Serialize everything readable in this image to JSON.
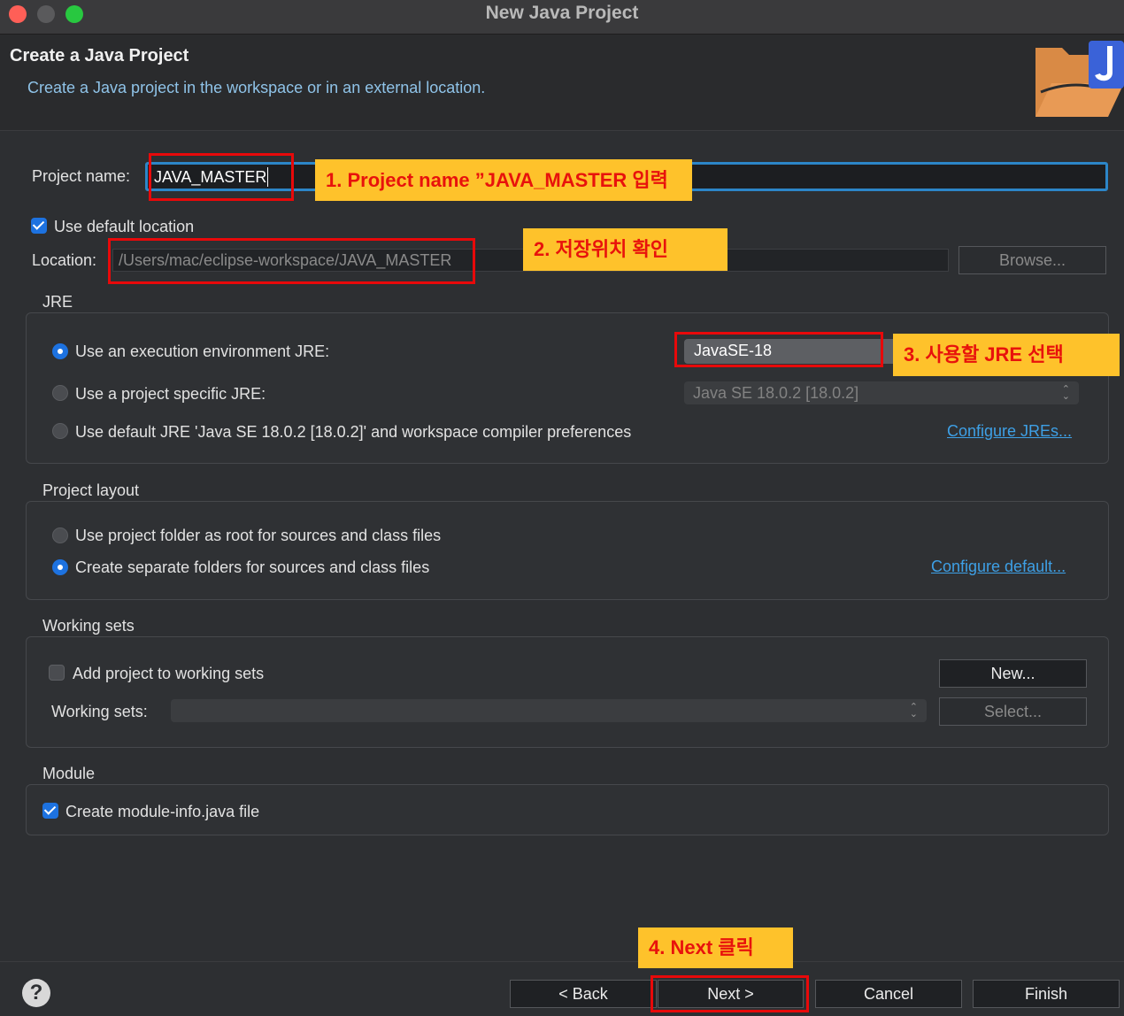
{
  "window": {
    "title": "New Java Project"
  },
  "header": {
    "title": "Create a Java Project",
    "description": "Create a Java project in the workspace or in an external location."
  },
  "project": {
    "name_label": "Project name:",
    "name_value": "JAVA_MASTER"
  },
  "location": {
    "use_default_label": "Use default location",
    "use_default_checked": true,
    "label": "Location:",
    "value": "/Users/mac/eclipse-workspace/JAVA_MASTER",
    "browse_label": "Browse..."
  },
  "jre": {
    "group_label": "JRE",
    "option_exec_env": "Use an execution environment JRE:",
    "exec_env_value": "JavaSE-18",
    "option_specific": "Use a project specific JRE:",
    "specific_value": "Java SE 18.0.2 [18.0.2]",
    "option_default": "Use default JRE 'Java SE 18.0.2 [18.0.2]' and workspace compiler preferences",
    "configure_link": "Configure JREs..."
  },
  "layout": {
    "group_label": "Project layout",
    "option_root": "Use project folder as root for sources and class files",
    "option_separate": "Create separate folders for sources and class files",
    "configure_link": "Configure default..."
  },
  "working_sets": {
    "group_label": "Working sets",
    "add_label": "Add project to working sets",
    "sets_label": "Working sets:",
    "new_button": "New...",
    "select_button": "Select..."
  },
  "module": {
    "group_label": "Module",
    "create_label": "Create module-info.java file",
    "checked": true
  },
  "footer": {
    "back": "< Back",
    "next": "Next >",
    "cancel": "Cancel",
    "finish": "Finish",
    "help": "?"
  },
  "annotations": {
    "step1": "1. Project name ”JAVA_MASTER 입력",
    "step2": "2. 저장위치 확인",
    "step3": "3. 사용할 JRE 선택",
    "step4": "4. Next 클릭"
  },
  "colors": {
    "accent": "#1d72e0",
    "link": "#3ea0e6",
    "annotation_bg": "#fec22b",
    "annotation_text": "#e8120c",
    "highlight_border": "#e8090a"
  }
}
